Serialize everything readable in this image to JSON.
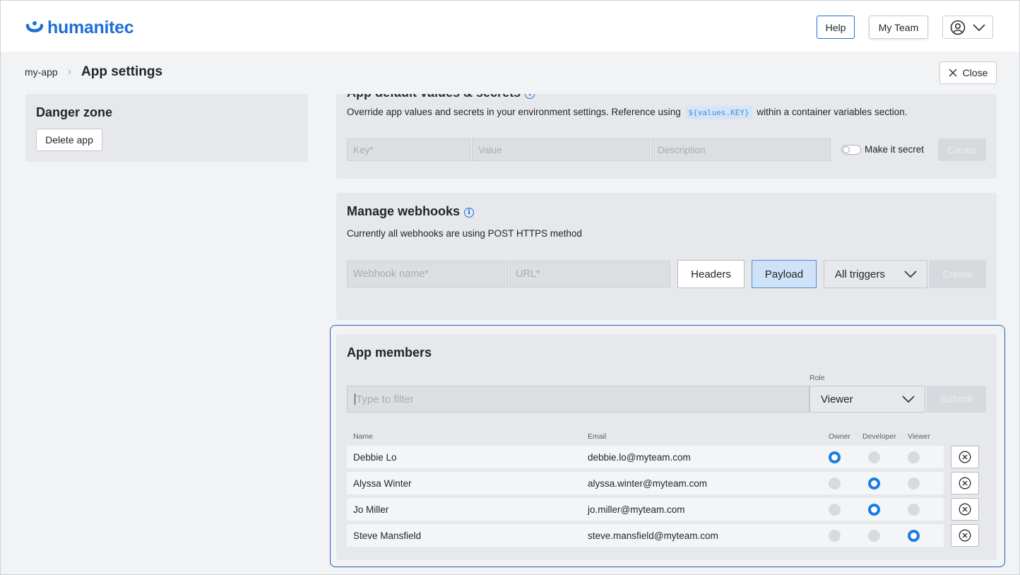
{
  "header": {
    "logo_text": "humanitec",
    "help_label": "Help",
    "team_label": "My Team",
    "brand_color": "#1e6fd8"
  },
  "breadcrumb": {
    "app": "my-app",
    "title": "App settings"
  },
  "close_label": "Close",
  "danger_zone": {
    "title": "Danger zone",
    "delete_label": "Delete app"
  },
  "values": {
    "title": "App default values & secrets",
    "description_before": "Override app values and secrets in your environment settings. Reference using",
    "code": "${values.KEY}",
    "description_after": "within a container variables section.",
    "key_placeholder": "Key*",
    "value_placeholder": "Value",
    "description_placeholder": "Description",
    "secret_label": "Make it secret",
    "create_label": "Create"
  },
  "webhooks": {
    "title": "Manage webhooks",
    "description": "Currently all webhooks are using POST HTTPS method",
    "name_placeholder": "Webhook name*",
    "url_placeholder": "URL*",
    "headers_label": "Headers",
    "payload_label": "Payload",
    "triggers_value": "All triggers",
    "create_label": "Create"
  },
  "members": {
    "title": "App members",
    "role_label": "Role",
    "filter_placeholder": "Type to filter",
    "role_value": "Viewer",
    "submit_label": "Submit",
    "columns": {
      "name": "Name",
      "email": "Email",
      "owner": "Owner",
      "developer": "Developer",
      "viewer": "Viewer"
    },
    "rows": [
      {
        "name": "Debbie Lo",
        "email": "debbie.lo@myteam.com",
        "role": "owner"
      },
      {
        "name": "Alyssa Winter",
        "email": "alyssa.winter@myteam.com",
        "role": "developer"
      },
      {
        "name": "Jo Miller",
        "email": "jo.miller@myteam.com",
        "role": "developer"
      },
      {
        "name": "Steve Mansfield",
        "email": "steve.mansfield@myteam.com",
        "role": "viewer"
      }
    ]
  }
}
